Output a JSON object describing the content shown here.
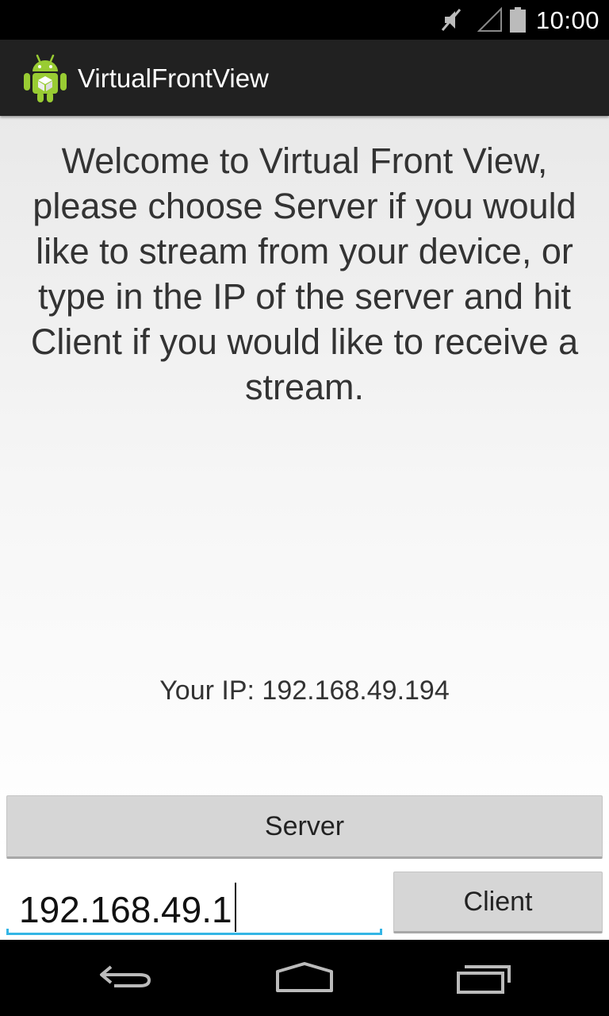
{
  "status_bar": {
    "time": "10:00",
    "icons": [
      "mute-icon",
      "signal-icon",
      "battery-icon"
    ]
  },
  "action_bar": {
    "app_icon": "android-app-icon",
    "title": "VirtualFrontView"
  },
  "main": {
    "welcome_text": "Welcome to Virtual Front View, please choose Server if you would like to stream from your device, or type in the IP of the server and hit Client if you would like to receive a stream.",
    "ip_label": "Your IP: 192.168.49.194",
    "server_button": "Server",
    "ip_input_value": "192.168.49.1",
    "client_button": "Client"
  },
  "nav_bar": {
    "buttons": [
      "back-icon",
      "home-icon",
      "recents-icon"
    ]
  },
  "colors": {
    "accent": "#33b5e5",
    "action_bar": "#212121",
    "button": "#d6d6d6"
  }
}
